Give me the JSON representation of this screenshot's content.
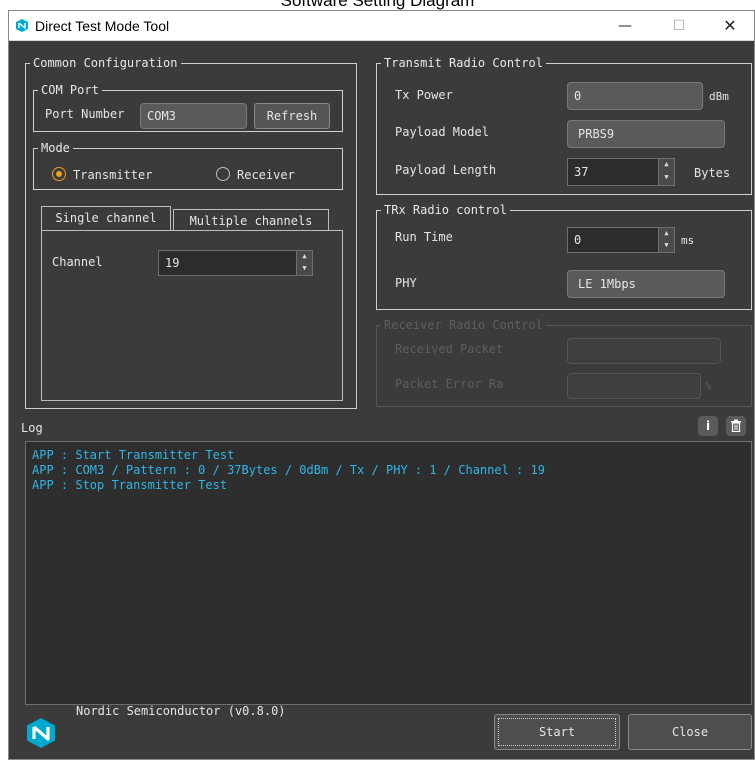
{
  "caption": "Software Setting Diagram",
  "window": {
    "title": "Direct Test Mode Tool",
    "minimize": "—",
    "maximize": "☐",
    "close": "✕"
  },
  "common": {
    "title": "Common Configuration",
    "com_port": {
      "title": "COM Port",
      "port_label": "Port Number",
      "port_value": "COM3",
      "refresh": "Refresh"
    },
    "mode": {
      "title": "Mode",
      "transmitter": "Transmitter",
      "receiver": "Receiver",
      "selected": "Transmitter"
    },
    "tabs": [
      "Single channel",
      "Multiple channels"
    ],
    "channel_label": "Channel",
    "channel_value": "19"
  },
  "transmit": {
    "title": "Transmit Radio Control",
    "tx_power_label": "Tx Power",
    "tx_power_value": "0",
    "tx_power_unit": "dBm",
    "payload_model_label": "Payload Model",
    "payload_model_value": "PRBS9",
    "payload_length_label": "Payload Length",
    "payload_length_value": "37",
    "payload_length_unit": "Bytes"
  },
  "trx": {
    "title": "TRx Radio control",
    "run_time_label": "Run Time",
    "run_time_value": "0",
    "run_time_unit": "ms",
    "phy_label": "PHY",
    "phy_value": "LE 1Mbps"
  },
  "receiver": {
    "title": "Receiver Radio Control",
    "received_packet_label": "Received Packet",
    "per_label": "Packet Error Ra",
    "per_unit": "%"
  },
  "log": {
    "title": "Log",
    "info_icon": "info-icon",
    "trash_icon": "trash-icon",
    "lines": [
      "APP : Start Transmitter Test",
      "APP : COM3 / Pattern : 0 / 37Bytes / 0dBm / Tx / PHY : 1 / Channel : 19",
      "APP : Stop Transmitter Test"
    ]
  },
  "footer": {
    "brand": "Nordic Semiconductor (v0.8.0)",
    "start": "Start",
    "close": "Close"
  },
  "colors": {
    "background": "#3b3b3b",
    "accent": "#f0a020",
    "log_text": "#2fb6e8",
    "nordic_blue": "#00a9ce"
  }
}
